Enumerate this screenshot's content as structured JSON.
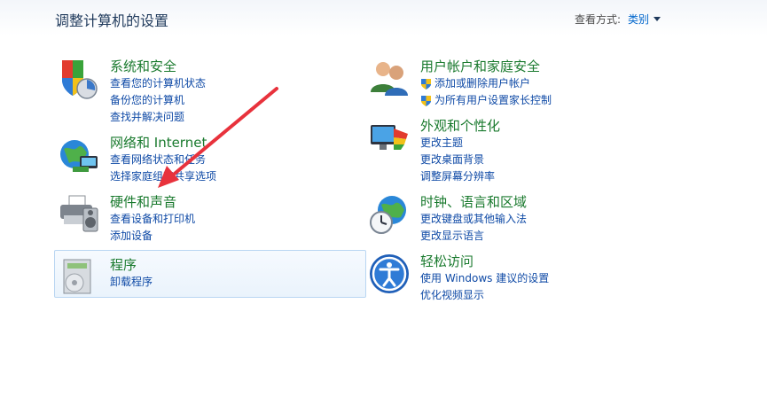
{
  "header": {
    "title": "调整计算机的设置",
    "view_by_label": "查看方式:",
    "view_by_value": "类别"
  },
  "categories": [
    {
      "title": "系统和安全",
      "icon": "shield-chart-icon",
      "links": [
        "查看您的计算机状态",
        "备份您的计算机",
        "查找并解决问题"
      ]
    },
    {
      "title": "网络和 Internet",
      "icon": "globe-network-icon",
      "links": [
        "查看网络状态和任务",
        "选择家庭组和共享选项"
      ]
    },
    {
      "title": "硬件和声音",
      "icon": "printer-speaker-icon",
      "links": [
        "查看设备和打印机",
        "添加设备"
      ]
    },
    {
      "title": "程序",
      "icon": "programs-box-icon",
      "links": [
        "卸载程序"
      ]
    },
    {
      "title": "用户帐户和家庭安全",
      "icon": "users-icon",
      "links": [
        "添加或删除用户帐户",
        "为所有用户设置家长控制"
      ]
    },
    {
      "title": "外观和个性化",
      "icon": "monitor-palette-icon",
      "links": [
        "更改主题",
        "更改桌面背景",
        "调整屏幕分辨率"
      ]
    },
    {
      "title": "时钟、语言和区域",
      "icon": "globe-clock-icon",
      "links": [
        "更改键盘或其他输入法",
        "更改显示语言"
      ]
    },
    {
      "title": "轻松访问",
      "icon": "ease-of-access-icon",
      "links": [
        "使用 Windows 建议的设置",
        "优化视频显示"
      ]
    }
  ],
  "colors": {
    "category_title": "#1a7a2e",
    "link": "#0f4aa6",
    "annotation_arrow": "#e8323c"
  }
}
